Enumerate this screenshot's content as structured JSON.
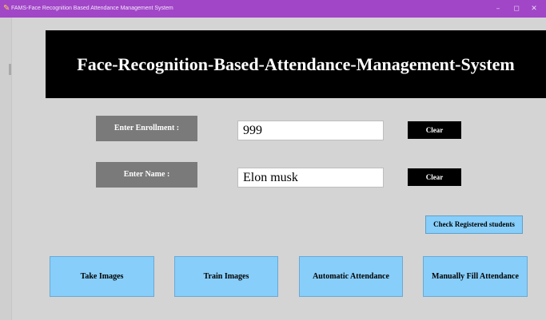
{
  "window": {
    "title": "FAMS-Face Recognition Based Attendance Management System",
    "controls": {
      "minimize": "–",
      "maximize": "◻",
      "close": "✕"
    },
    "icon": "feather-icon"
  },
  "banner": {
    "title": "Face-Recognition-Based-Attendance-Management-System"
  },
  "form": {
    "enrollment": {
      "label": "Enter Enrollment :",
      "value": "999",
      "clear_label": "Clear"
    },
    "name": {
      "label": "Enter Name :",
      "value": "Elon musk",
      "clear_label": "Clear"
    }
  },
  "actions": {
    "check_registered": "Check Registered students",
    "take_images": "Take Images",
    "train_images": "Train Images",
    "automatic_attendance": "Automatic Attendance",
    "manual_attendance": "Manually Fill Attendance"
  },
  "colors": {
    "titlebar": "#a146c7",
    "window_bg": "#d4d4d4",
    "banner_bg": "#000000",
    "label_bg": "#7a7a7a",
    "action_button_bg": "#87cefa",
    "clear_button_bg": "#000000"
  }
}
